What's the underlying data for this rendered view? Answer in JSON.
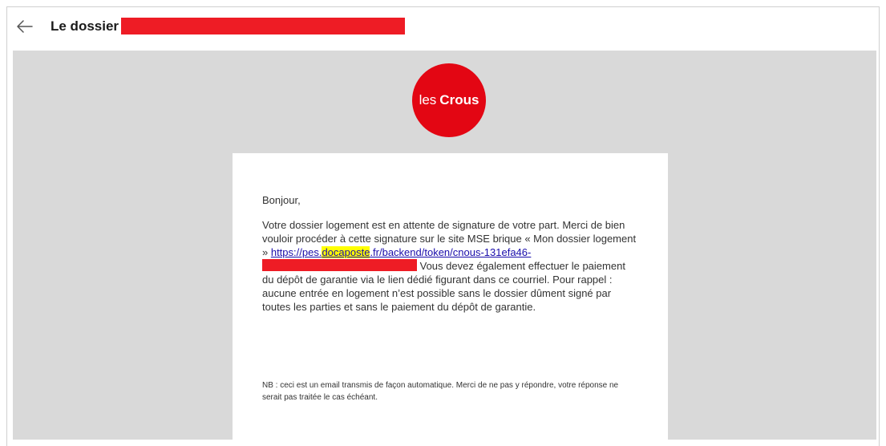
{
  "header": {
    "back_icon": "arrow-left-icon",
    "title": "Le dossier"
  },
  "logo": {
    "prefix": "les",
    "brand": "Crous",
    "color": "#e30613"
  },
  "email": {
    "greeting": "Bonjour,",
    "para_start": "Votre dossier logement est en attente de signature de votre part. Merci de bien vouloir procéder à cette signature sur le site MSE brique « Mon dossier logement » ",
    "link_part1": "https://pes.",
    "link_highlight": "docaposte",
    "link_part2": ".fr/backend/token/cnous-131efa46-",
    "para_end": " Vous devez également effectuer le paiement du dépôt de garantie via le lien dédié figurant dans ce courriel. Pour rappel : aucune entrée en logement n’est possible sans le dossier dûment signé par toutes les parties et sans le paiement du dépôt de garantie.",
    "nb": "NB : ceci est un email transmis de façon automatique. Merci de ne pas y répondre, votre réponse ne serait pas traitée le cas échéant."
  },
  "colors": {
    "redaction": "#ee1c25",
    "highlight": "#ffff00",
    "link": "#1a0dab",
    "background": "#d9d9d9"
  }
}
